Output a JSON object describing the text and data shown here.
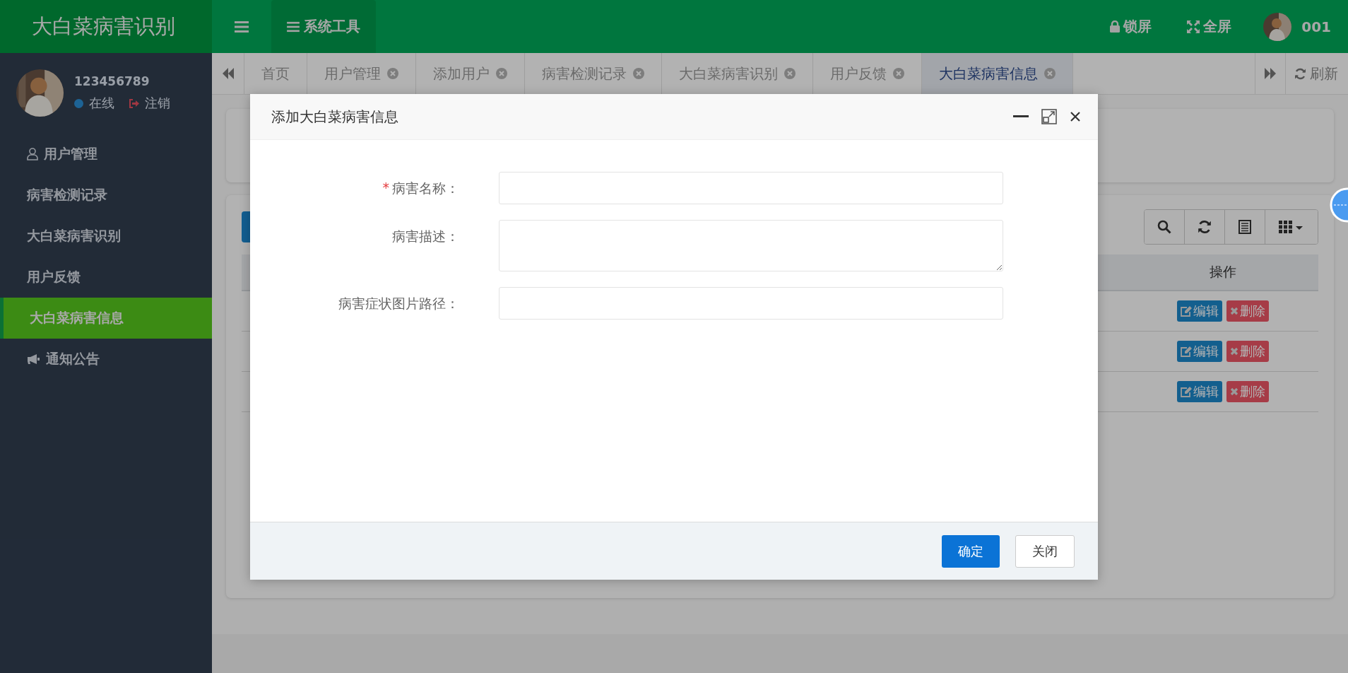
{
  "header": {
    "brand": "大白菜病害识别",
    "tool_menu": "系统工具",
    "lock": "锁屏",
    "fullscreen": "全屏",
    "username": "001"
  },
  "sidebar": {
    "user": {
      "name": "123456789",
      "status": "在线",
      "logout": "注销"
    },
    "items": [
      {
        "label": "用户管理",
        "kind": "user",
        "selected": false
      },
      {
        "label": "病害检测记录",
        "kind": "plain",
        "selected": false
      },
      {
        "label": "大白菜病害识别",
        "kind": "plain",
        "selected": false
      },
      {
        "label": "用户反馈",
        "kind": "plain",
        "selected": false
      },
      {
        "label": "大白菜病害信息",
        "kind": "plain",
        "selected": true
      },
      {
        "label": "通知公告",
        "kind": "megaphone",
        "selected": false
      }
    ]
  },
  "tabs": {
    "items": [
      {
        "label": "首页",
        "closable": false,
        "selected": false
      },
      {
        "label": "用户管理",
        "closable": true,
        "selected": false
      },
      {
        "label": "添加用户",
        "closable": true,
        "selected": false
      },
      {
        "label": "病害检测记录",
        "closable": true,
        "selected": false
      },
      {
        "label": "大白菜病害识别",
        "closable": true,
        "selected": false
      },
      {
        "label": "用户反馈",
        "closable": true,
        "selected": false
      },
      {
        "label": "大白菜病害信息",
        "closable": true,
        "selected": true
      }
    ],
    "refresh": "刷新"
  },
  "page": {
    "table": {
      "columns": [
        {
          "label": "操作"
        }
      ],
      "rows": [
        {
          "edit": "编辑",
          "delete": "删除"
        },
        {
          "edit": "编辑",
          "delete": "删除"
        },
        {
          "edit": "编辑",
          "delete": "删除"
        }
      ]
    }
  },
  "dialog": {
    "title": "添加大白菜病害信息",
    "required_mark": "*",
    "fields": [
      {
        "label": "病害名称：",
        "required": true,
        "kind": "input"
      },
      {
        "label": "病害描述：",
        "required": false,
        "kind": "textarea"
      },
      {
        "label": "病害症状图片路径：",
        "required": false,
        "kind": "input"
      }
    ],
    "buttons": [
      {
        "label": "确定",
        "kind": "primary"
      },
      {
        "label": "关闭",
        "kind": "default"
      }
    ]
  }
}
